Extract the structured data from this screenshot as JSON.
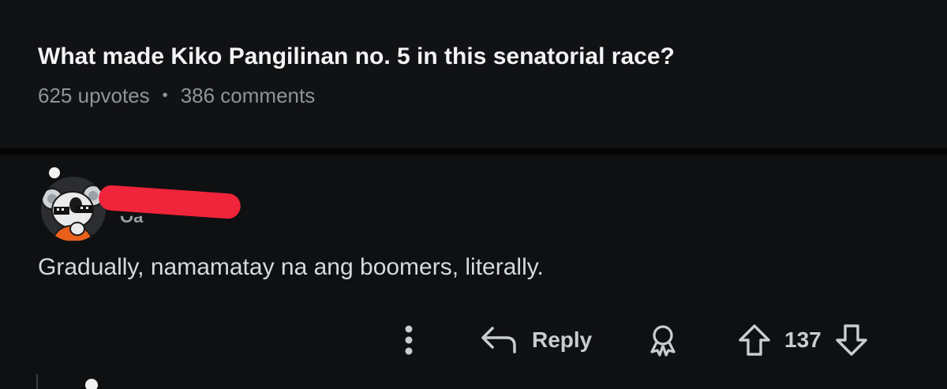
{
  "post": {
    "title": "What made Kiko Pangilinan no. 5 in this senatorial race?",
    "upvotes": "625 upvotes",
    "separator": "•",
    "comments": "386 comments"
  },
  "comment": {
    "username": "Oa",
    "body": "Gradually, namamatay na ang boomers, literally.",
    "actions": {
      "reply_label": "Reply",
      "vote_count": "137"
    }
  },
  "icons": {
    "more": "more-vertical-icon",
    "reply": "reply-arrow-icon",
    "award": "award-icon",
    "upvote": "upvote-arrow-icon",
    "downvote": "downvote-arrow-icon"
  },
  "colors": {
    "background": "#0f1012",
    "title": "#f2f3f5",
    "meta": "#8e949a",
    "redaction": "#f0243a"
  }
}
